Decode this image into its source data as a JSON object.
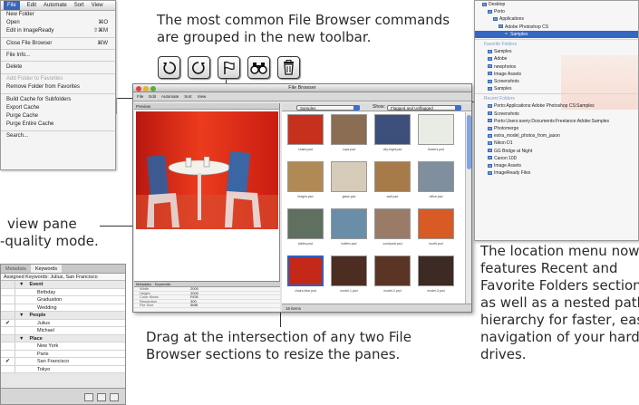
{
  "captions": {
    "toolbar_line1": "The most common File Browser commands",
    "toolbar_line2": "are grouped in the new toolbar.",
    "preview_line1": "view pane",
    "preview_line2": "-quality mode.",
    "resize_line1": "Drag at the intersection of any two File",
    "resize_line2": "Browser sections to resize the panes.",
    "location_lines": [
      "The location menu now",
      "features Recent and",
      "Favorite Folders section",
      "as well as a nested path",
      "hierarchy for faster, easie",
      "navigation of your hard",
      "drives."
    ]
  },
  "file_menu": {
    "menubar": [
      "File",
      "Edit",
      "Automate",
      "Sort",
      "View"
    ],
    "items": [
      {
        "label": "New Folder",
        "shortcut": ""
      },
      {
        "label": "Open",
        "shortcut": "⌘O"
      },
      {
        "label": "Edit in ImageReady",
        "shortcut": "⇧⌘M"
      },
      {
        "sep": true
      },
      {
        "label": "Close File Browser",
        "shortcut": "⌘W"
      },
      {
        "sep": true
      },
      {
        "label": "File Info...",
        "shortcut": ""
      },
      {
        "sep": true
      },
      {
        "label": "Delete",
        "shortcut": ""
      },
      {
        "sep": true
      },
      {
        "label": "Add Folder to Favorites",
        "shortcut": "",
        "disabled": true
      },
      {
        "label": "Remove Folder from Favorites",
        "shortcut": ""
      },
      {
        "sep": true
      },
      {
        "label": "Build Cache for Subfolders",
        "shortcut": ""
      },
      {
        "label": "Export Cache",
        "shortcut": ""
      },
      {
        "label": "Purge Cache",
        "shortcut": ""
      },
      {
        "label": "Purge Entire Cache",
        "shortcut": ""
      },
      {
        "sep": true
      },
      {
        "label": "Search...",
        "shortcut": ""
      }
    ]
  },
  "keywords_palette": {
    "tabs": [
      "Metadata",
      "Keywords"
    ],
    "assigned": "Assigned Keywords: Julius, San Francisco",
    "rows": [
      {
        "label": "Event",
        "group": true,
        "checked": false
      },
      {
        "label": "Birthday",
        "group": false,
        "checked": false
      },
      {
        "label": "Graduation",
        "group": false,
        "checked": false
      },
      {
        "label": "Wedding",
        "group": false,
        "checked": false
      },
      {
        "label": "People",
        "group": true,
        "checked": false
      },
      {
        "label": "Julius",
        "group": false,
        "checked": true
      },
      {
        "label": "Michael",
        "group": false,
        "checked": false
      },
      {
        "label": "Place",
        "group": true,
        "checked": false
      },
      {
        "label": "New York",
        "group": false,
        "checked": false
      },
      {
        "label": "Paris",
        "group": false,
        "checked": false
      },
      {
        "label": "San Francisco",
        "group": false,
        "checked": true
      },
      {
        "label": "Tokyo",
        "group": false,
        "checked": false
      }
    ]
  },
  "toolbar_icons": [
    "rotate-left-icon",
    "rotate-right-icon",
    "flag-icon",
    "binoculars-icon",
    "trash-icon"
  ],
  "file_browser": {
    "title": "File Browser",
    "menu": [
      "File",
      "Edit",
      "Automate",
      "Sort",
      "View"
    ],
    "preview_tab": "Preview",
    "location": "Samples",
    "show_label": "Show:",
    "show_value": "Flagged and Unflagged",
    "meta_tabs": [
      "Metadata",
      "Keywords"
    ],
    "meta_rows": [
      {
        "k": "Width",
        "v": "2000"
      },
      {
        "k": "Height",
        "v": "2000"
      },
      {
        "k": "Color Mode",
        "v": "RGB"
      },
      {
        "k": "Resolution",
        "v": "300"
      },
      {
        "k": "File Size",
        "v": "5MB"
      }
    ],
    "thumbs": [
      {
        "label": "chairs.psd",
        "color": "#c6311d"
      },
      {
        "label": "cups.psd",
        "color": "#8a6d52"
      },
      {
        "label": "city-night.psd",
        "color": "#3c4f7b"
      },
      {
        "label": "flowers.psd",
        "color": "#e9ece4"
      },
      {
        "label": "ledges.psd",
        "color": "#b08a56"
      },
      {
        "label": "glass.psd",
        "color": "#d6cbb8"
      },
      {
        "label": "wall.psd",
        "color": "#a77a4a"
      },
      {
        "label": "office.psd",
        "color": "#7f8f9d"
      },
      {
        "label": "tables.psd",
        "color": "#5f6f60"
      },
      {
        "label": "bottles.psd",
        "color": "#6a8ea8"
      },
      {
        "label": "courtyard.psd",
        "color": "#9a7b68"
      },
      {
        "label": "booth.psd",
        "color": "#d85a24"
      },
      {
        "label": "chairs-blue.psd",
        "color": "#c42819"
      },
      {
        "label": "model-1.psd",
        "color": "#4d2d22"
      },
      {
        "label": "model-2.psd",
        "color": "#5a3424"
      },
      {
        "label": "model-3.psd",
        "color": "#3d2a24"
      }
    ],
    "status": "16 items"
  },
  "location_menu": {
    "top": [
      {
        "label": "Desktop",
        "indent": 0
      },
      {
        "label": "Porto",
        "indent": 1
      },
      {
        "label": "Applications",
        "indent": 2
      },
      {
        "label": "Adobe Photoshop CS",
        "indent": 3
      },
      {
        "label": "Samples",
        "indent": 4,
        "selected": true
      }
    ],
    "favorites_header": "Favorite Folders",
    "favorites": [
      "Samples",
      "Adobe",
      "newphotos",
      "Image Assets",
      "Screenshots",
      "Samples"
    ],
    "recent_header": "Recent Folders",
    "recent": [
      "Porto:Applications:Adobe Photoshop CS:Samples",
      "Screenshots",
      "Porto:Users:avery:Documents:Freelance:Adobe:Samples",
      "Photomerge",
      "extra_model_photos_from_jason",
      "Nikon D1",
      "GG Bridge at Night",
      "Canon 10D",
      "Image Assets",
      "ImageReady Files"
    ]
  }
}
